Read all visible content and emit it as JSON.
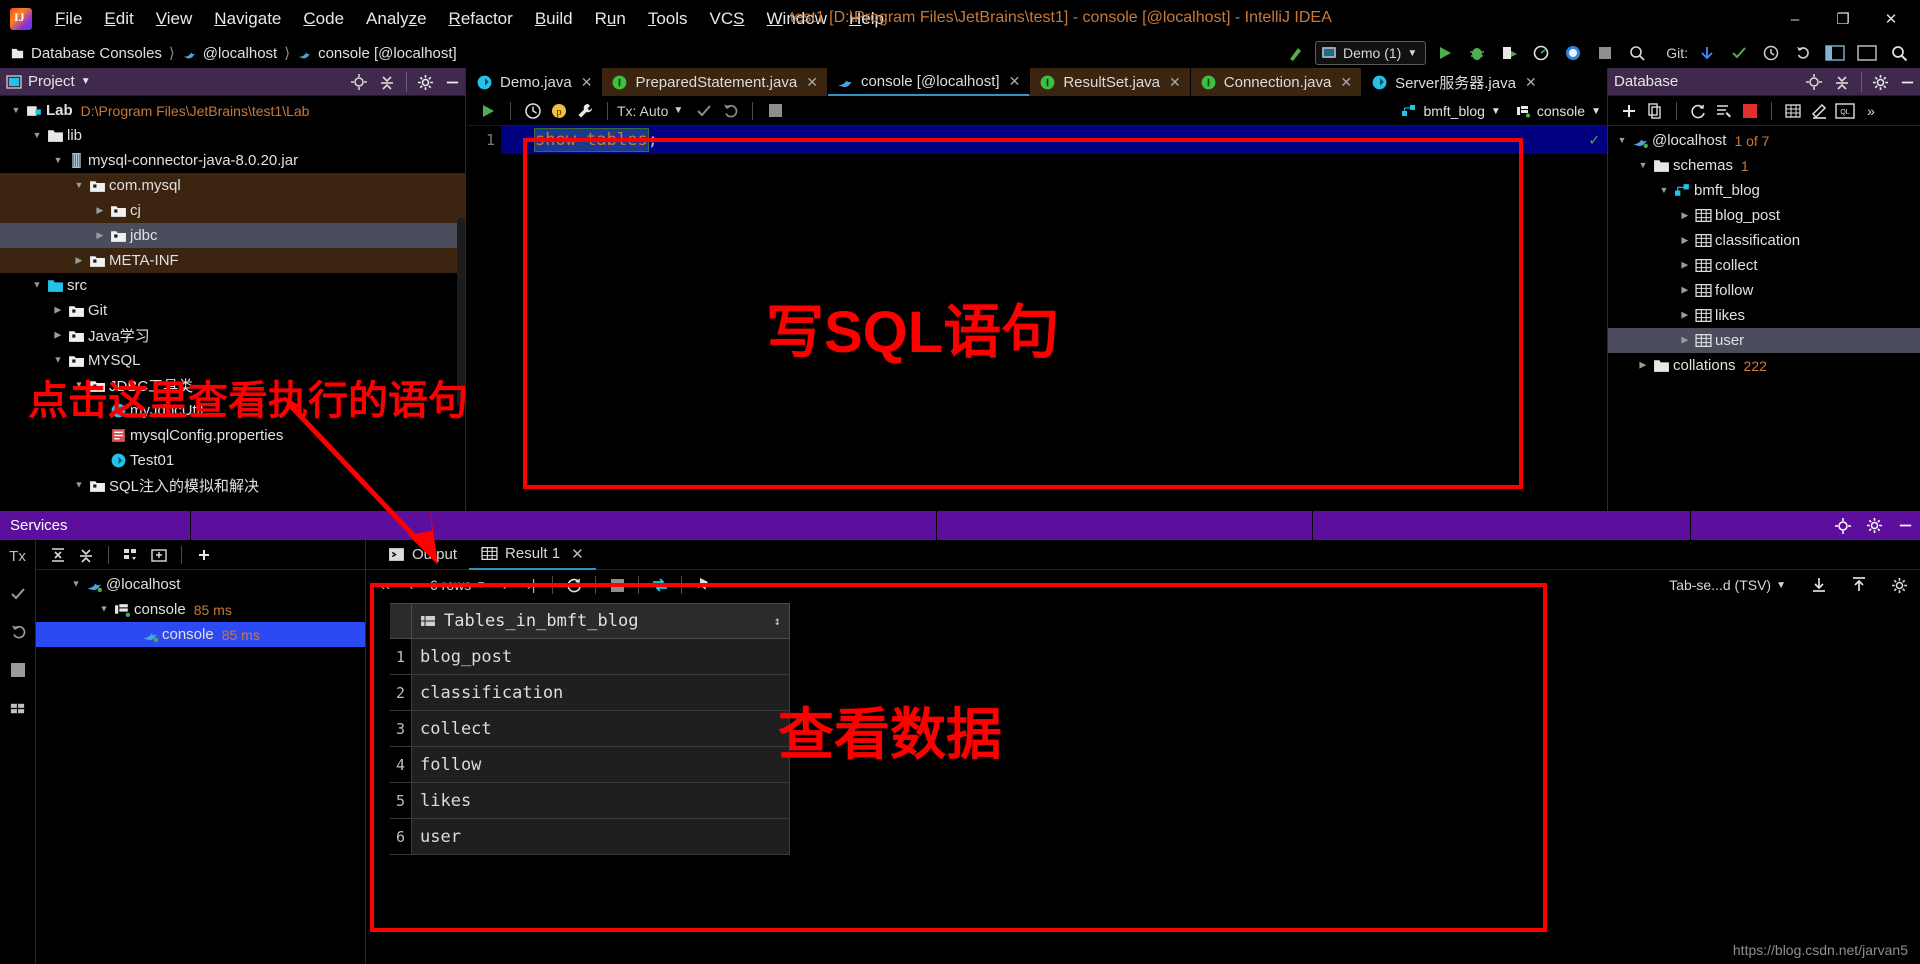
{
  "titlebar": {
    "logo": "intellij-logo",
    "menu": [
      "File",
      "Edit",
      "View",
      "Navigate",
      "Code",
      "Analyze",
      "Refactor",
      "Build",
      "Run",
      "Tools",
      "VCS",
      "Window",
      "Help"
    ],
    "window_title": "test1 [D:\\Program Files\\JetBrains\\test1] - console [@localhost] - IntelliJ IDEA",
    "minimize": "–",
    "maximize": "❐",
    "close": "✕"
  },
  "navbar": {
    "crumbs": [
      "Database Consoles",
      "@localhost",
      "console [@localhost]"
    ],
    "run_config": "Demo (1)",
    "git_label": "Git:"
  },
  "project_panel": {
    "title": "Project",
    "tree": [
      {
        "indent": 0,
        "arrow": "down",
        "icon": "module-icon",
        "label": "Lab",
        "bold": true,
        "sub": "D:\\Program Files\\JetBrains\\test1\\Lab",
        "state": "normal"
      },
      {
        "indent": 1,
        "arrow": "down",
        "icon": "folder-icon",
        "label": "lib",
        "sub": "",
        "state": "normal"
      },
      {
        "indent": 2,
        "arrow": "down",
        "icon": "jar-icon",
        "label": "mysql-connector-java-8.0.20.jar",
        "sub": "",
        "state": "normal"
      },
      {
        "indent": 3,
        "arrow": "down",
        "icon": "package-icon",
        "label": "com.mysql",
        "sub": "",
        "state": "brown"
      },
      {
        "indent": 4,
        "arrow": "right",
        "icon": "package-icon",
        "label": "cj",
        "sub": "",
        "state": "brown"
      },
      {
        "indent": 4,
        "arrow": "right",
        "icon": "package-icon",
        "label": "jdbc",
        "sub": "",
        "state": "selgrey"
      },
      {
        "indent": 3,
        "arrow": "right",
        "icon": "package-icon",
        "label": "META-INF",
        "sub": "",
        "state": "brown"
      },
      {
        "indent": 1,
        "arrow": "down",
        "icon": "source-folder-icon",
        "label": "src",
        "sub": "",
        "state": "normal"
      },
      {
        "indent": 2,
        "arrow": "right",
        "icon": "package-icon",
        "label": "Git",
        "sub": "",
        "state": "normal"
      },
      {
        "indent": 2,
        "arrow": "right",
        "icon": "package-icon",
        "label": "Java学习",
        "sub": "",
        "state": "normal"
      },
      {
        "indent": 2,
        "arrow": "down",
        "icon": "package-icon",
        "label": "MYSQL",
        "sub": "",
        "state": "normal"
      },
      {
        "indent": 3,
        "arrow": "down",
        "icon": "package-icon",
        "label": "JDBC工具类",
        "sub": "",
        "state": "normal"
      },
      {
        "indent": 4,
        "arrow": "none",
        "icon": "class-icon",
        "label": "myJdbcUtil",
        "sub": "",
        "state": "normal"
      },
      {
        "indent": 4,
        "arrow": "none",
        "icon": "properties-icon",
        "label": "mysqlConfig.properties",
        "sub": "",
        "state": "normal"
      },
      {
        "indent": 4,
        "arrow": "none",
        "icon": "class-icon",
        "label": "Test01",
        "sub": "",
        "state": "normal"
      },
      {
        "indent": 3,
        "arrow": "down",
        "icon": "package-icon",
        "label": "SQL注入的模拟和解决",
        "sub": "",
        "state": "normal"
      }
    ]
  },
  "editor": {
    "tabs": [
      {
        "label": "Demo.java",
        "icon": "java-class-icon",
        "state": "normal",
        "closable": true
      },
      {
        "label": "PreparedStatement.java",
        "icon": "interface-icon",
        "state": "brown",
        "closable": true
      },
      {
        "label": "console [@localhost]",
        "icon": "console-icon",
        "state": "active",
        "closable": true
      },
      {
        "label": "ResultSet.java",
        "icon": "interface-icon",
        "state": "brown",
        "closable": true
      },
      {
        "label": "Connection.java",
        "icon": "interface-icon",
        "state": "brown",
        "closable": true
      },
      {
        "label": "Server服务器.java",
        "icon": "java-class-icon",
        "state": "normal",
        "closable": true
      }
    ],
    "toolbar": {
      "run": "run-icon",
      "history": "history-icon",
      "params": "parameters-icon",
      "settings": "wrench-icon",
      "tx_label": "Tx: Auto",
      "commit": "commit-icon",
      "rollback": "rollback-icon",
      "stop": "stop-icon",
      "schema": "bmft_blog",
      "session": "console"
    },
    "line_number": "1",
    "code_keyword": "show tables",
    "code_punct": ";",
    "ok_mark": "✓"
  },
  "database_panel": {
    "title": "Database",
    "toolbar_icons": [
      "add-icon",
      "copy-icon",
      "refresh-icon",
      "sync-settings-icon",
      "stop-icon",
      "table-editor-icon",
      "edit-icon",
      "query-console-icon",
      "more-icon"
    ],
    "tree": [
      {
        "indent": 0,
        "arrow": "down",
        "icon": "datasource-icon",
        "label": "@localhost",
        "sub": "1 of 7",
        "state": "normal"
      },
      {
        "indent": 1,
        "arrow": "down",
        "icon": "folder-icon",
        "label": "schemas",
        "sub": "1",
        "state": "normal"
      },
      {
        "indent": 2,
        "arrow": "down",
        "icon": "schema-icon",
        "label": "bmft_blog",
        "sub": "",
        "state": "normal"
      },
      {
        "indent": 3,
        "arrow": "right",
        "icon": "table-icon",
        "label": "blog_post",
        "sub": "",
        "state": "normal"
      },
      {
        "indent": 3,
        "arrow": "right",
        "icon": "table-icon",
        "label": "classification",
        "sub": "",
        "state": "normal"
      },
      {
        "indent": 3,
        "arrow": "right",
        "icon": "table-icon",
        "label": "collect",
        "sub": "",
        "state": "normal"
      },
      {
        "indent": 3,
        "arrow": "right",
        "icon": "table-icon",
        "label": "follow",
        "sub": "",
        "state": "normal"
      },
      {
        "indent": 3,
        "arrow": "right",
        "icon": "table-icon",
        "label": "likes",
        "sub": "",
        "state": "normal"
      },
      {
        "indent": 3,
        "arrow": "right",
        "icon": "table-icon",
        "label": "user",
        "sub": "",
        "state": "selgrey"
      },
      {
        "indent": 1,
        "arrow": "right",
        "icon": "folder-icon",
        "label": "collations",
        "sub": "222",
        "state": "normal"
      }
    ]
  },
  "services": {
    "title": "Services",
    "rail_icons": [
      "tx-icon",
      "commit-icon",
      "rollback-icon",
      "stop-icon",
      "grid-icon"
    ],
    "tree_toolbar_icons": [
      "expand-all-icon",
      "collapse-all-icon",
      "group-icon",
      "new-tab-icon",
      "add-icon"
    ],
    "tree": [
      {
        "indent": 0,
        "arrow": "down",
        "icon": "datasource-icon",
        "label": "@localhost",
        "sub": "",
        "state": "normal"
      },
      {
        "indent": 1,
        "arrow": "down",
        "icon": "console-session-icon",
        "label": "console",
        "sub": "85 ms",
        "state": "normal"
      },
      {
        "indent": 2,
        "arrow": "none",
        "icon": "datasource-icon",
        "label": "console",
        "sub": "85 ms",
        "state": "selblue"
      }
    ]
  },
  "results": {
    "tabs": [
      {
        "label": "Output",
        "icon": "output-icon",
        "active": false
      },
      {
        "label": "Result 1",
        "icon": "table-icon",
        "active": true,
        "closable": true
      }
    ],
    "toolbar": {
      "first": "‹‹",
      "prev": "‹",
      "rows_label": "6 rows",
      "next": "›",
      "last": "›|",
      "reload": "refresh-icon",
      "stop": "stop-icon",
      "transpose": "transpose-icon",
      "pin": "pin-icon",
      "format_label": "Tab-se...d (TSV)",
      "download": "download-icon",
      "upload": "upload-icon",
      "settings": "gear-icon"
    },
    "grid": {
      "column_header": "Tables_in_bmft_blog",
      "rows": [
        {
          "n": "1",
          "value": "blog_post"
        },
        {
          "n": "2",
          "value": "classification"
        },
        {
          "n": "3",
          "value": "collect"
        },
        {
          "n": "4",
          "value": "follow"
        },
        {
          "n": "5",
          "value": "likes"
        },
        {
          "n": "6",
          "value": "user"
        }
      ]
    }
  },
  "annotations": {
    "sql_note": "写SQL语句",
    "click_note": "点击这里查看执行的语句",
    "data_note": "查看数据",
    "accent_red": "#ff0000"
  },
  "watermark": "https://blog.csdn.net/jarvan5"
}
